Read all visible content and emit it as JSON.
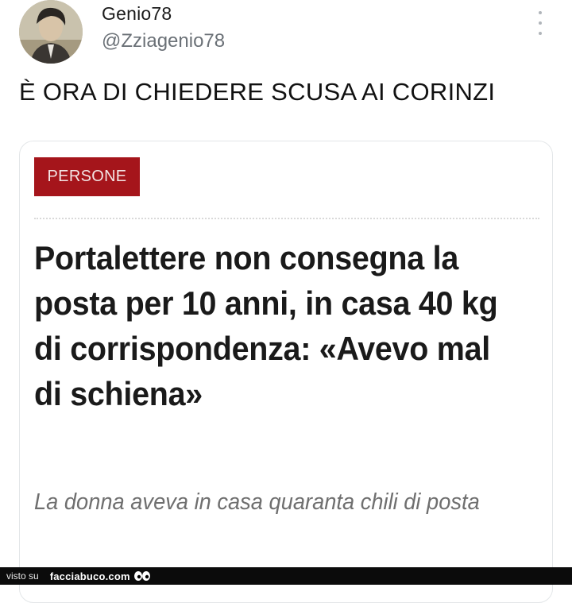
{
  "tweet": {
    "display_name": "Genio78",
    "handle": "@Zziagenio78",
    "text": "È ORA DI CHIEDERE SCUSA AI CORINZI",
    "avatar_icon": "user-avatar-photo",
    "more_icon": "vertical-ellipsis-icon"
  },
  "article_card": {
    "category": "PERSONE",
    "category_color": "#a5151b",
    "headline": "Portalettere non consegna la posta per 10 anni, in casa 40 kg di corrispondenza: «Avevo mal di schiena»",
    "summary": "La donna aveva in casa quaranta chili di posta"
  },
  "watermark": {
    "prefix": "visto su",
    "site": "facciabuco.com",
    "icon": "eyes-icon"
  }
}
